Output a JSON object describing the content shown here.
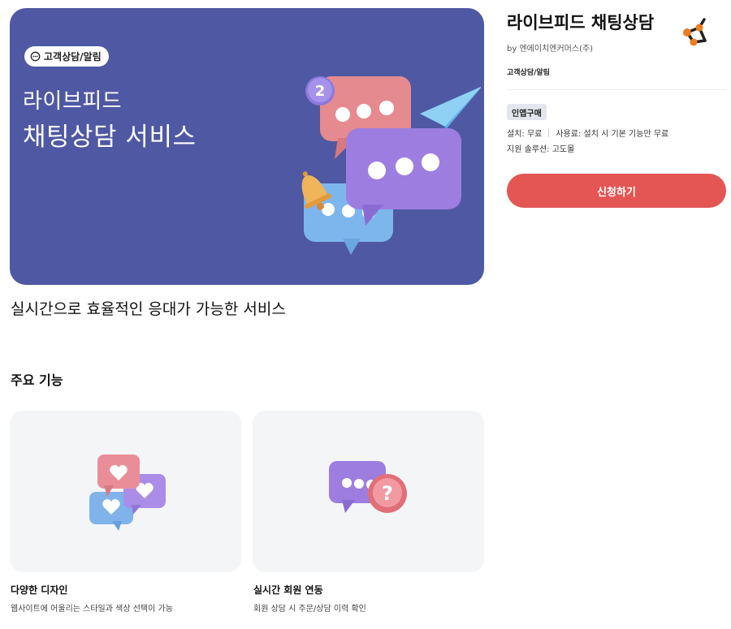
{
  "hero": {
    "chip_label": "고객상담/알림",
    "title_line1": "라이브피드",
    "title_line2": "채팅상담 서비스",
    "bg_color": "#4f58a3",
    "badge_number": "2"
  },
  "tagline": "실시간으로 효율적인 응대가 가능한 서비스",
  "features_section": {
    "title": "주요 기능",
    "items": [
      {
        "title": "다양한 디자인",
        "desc": "웹사이트에 어울리는 스타일과 색상 선택이 가능",
        "icon": "heart-chat-bubbles-icon"
      },
      {
        "title": "실시간 회원 연동",
        "desc": "회원 상담 시 주문/상담 이력 확인",
        "icon": "question-chat-bubble-icon"
      }
    ]
  },
  "app": {
    "title": "라이브피드 채팅상담",
    "vendor": "by 엔에이치엔커머스(주)",
    "category": "고객상담/알림",
    "badge": "인앱구매",
    "install": "설치: 무료",
    "usage": "사용료: 설치 시 기본 기능만 무료",
    "solution": "지원 솔루션: 고도몰",
    "apply_label": "신청하기",
    "accent_color": "#e35653"
  }
}
